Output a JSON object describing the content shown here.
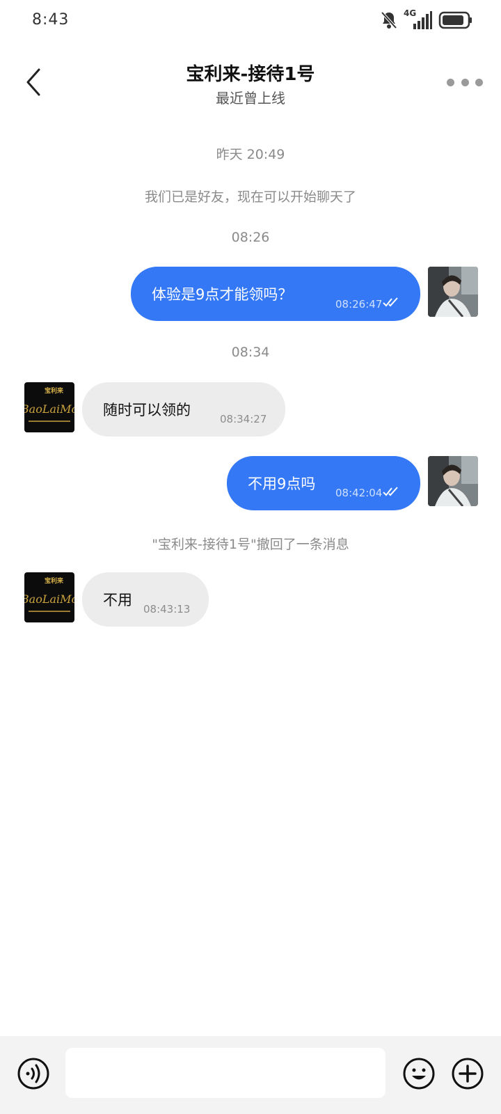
{
  "status_bar": {
    "time": "8:43",
    "network": "4G"
  },
  "header": {
    "title": "宝利来-接待1号",
    "subtitle": "最近曾上线"
  },
  "messages": {
    "sys1": "昨天 20:49",
    "sys2": "我们已是好友，现在可以开始聊天了",
    "sys3": "08:26",
    "m1_text": "体验是9点才能领吗？",
    "m1_time": "08:26:47",
    "sys4": "08:34",
    "m2_text": "随时可以领的",
    "m2_time": "08:34:27",
    "m3_text": "不用9点吗",
    "m3_time": "08:42:04",
    "sys5": "\"宝利来-接待1号\"撤回了一条消息",
    "m4_text": "不用",
    "m4_time": "08:43:13"
  },
  "avatars": {
    "agent_logo_top": "宝利来",
    "agent_logo_script": "BaoLaiMo"
  },
  "input": {
    "placeholder": ""
  },
  "colors": {
    "outgoing_bubble": "#3478f6",
    "incoming_bubble": "#ececec",
    "bottom_bar": "#f3f3f3"
  }
}
